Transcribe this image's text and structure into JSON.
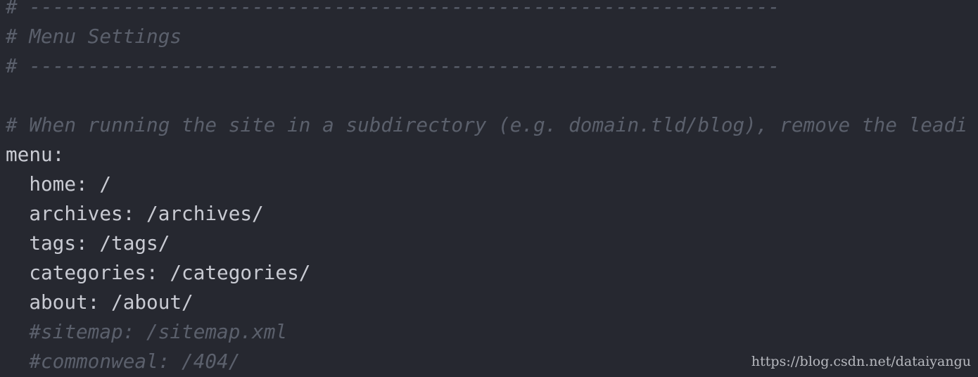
{
  "editor": {
    "lines": [
      {
        "text": "# ----------------------------------------------------------------",
        "kind": "comment"
      },
      {
        "text": "# Menu Settings",
        "kind": "comment"
      },
      {
        "text": "# ----------------------------------------------------------------",
        "kind": "comment"
      },
      {
        "text": "",
        "kind": "blank"
      },
      {
        "text": "# When running the site in a subdirectory (e.g. domain.tld/blog), remove the leadi",
        "kind": "comment"
      },
      {
        "text": "menu:",
        "kind": "code"
      },
      {
        "text": "  home: /",
        "kind": "code"
      },
      {
        "text": "  archives: /archives/",
        "kind": "code"
      },
      {
        "text": "  tags: /tags/",
        "kind": "code"
      },
      {
        "text": "  categories: /categories/",
        "kind": "code"
      },
      {
        "text": "  about: /about/",
        "kind": "code"
      },
      {
        "text": "  #sitemap: /sitemap.xml",
        "kind": "comment"
      },
      {
        "text": "  #commonweal: /404/",
        "kind": "comment"
      }
    ]
  },
  "watermark": "https://blog.csdn.net/dataiyangu"
}
